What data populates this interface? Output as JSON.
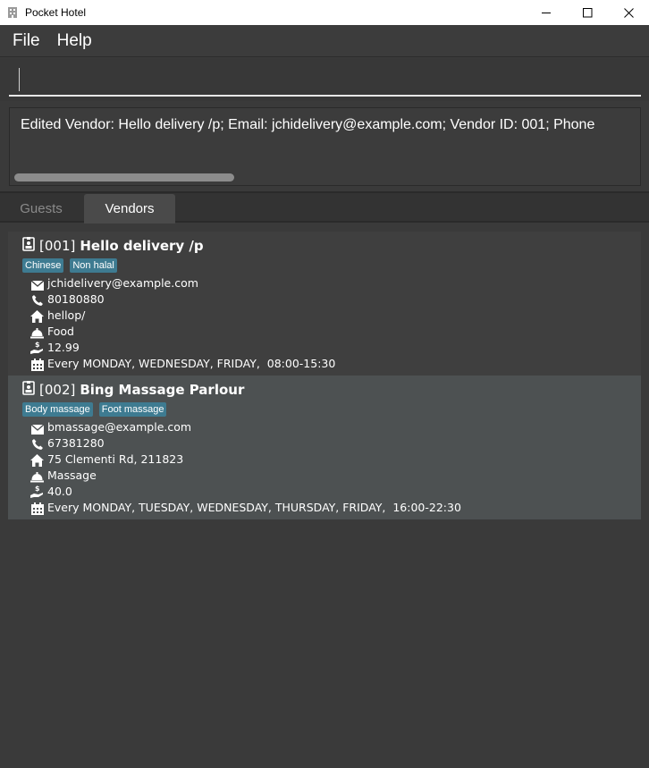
{
  "window": {
    "title": "Pocket Hotel",
    "controls": [
      "minimize-icon",
      "maximize-icon",
      "close-icon"
    ]
  },
  "menu": {
    "file": "File",
    "help": "Help"
  },
  "command": {
    "value": ""
  },
  "result": {
    "text": "Edited Vendor: Hello delivery /p; Email: jchidelivery@example.com; Vendor ID: 001; Phone"
  },
  "tabs": {
    "guests": "Guests",
    "vendors": "Vendors",
    "selected": "Vendors"
  },
  "vendors": [
    {
      "id": "[001]",
      "name": "Hello delivery /p",
      "tags": [
        "Chinese",
        "Non halal"
      ],
      "email": "jchidelivery@example.com",
      "phone": "80180880",
      "address": "hellop/",
      "service": "Food",
      "cost": "12.99",
      "schedule": "Every MONDAY, WEDNESDAY, FRIDAY,  08:00-15:30"
    },
    {
      "id": "[002]",
      "name": "Bing Massage Parlour",
      "tags": [
        "Body massage",
        "Foot massage"
      ],
      "email": "bmassage@example.com",
      "phone": "67381280",
      "address": "75 Clementi Rd, 211823",
      "service": "Massage",
      "cost": "40.0",
      "schedule": "Every MONDAY, TUESDAY, WEDNESDAY, THURSDAY, FRIDAY,  16:00-22:30"
    }
  ],
  "colors": {
    "background": "#3a3a3a",
    "tag": "#3e7b91",
    "selected_row": "#4d5152"
  }
}
